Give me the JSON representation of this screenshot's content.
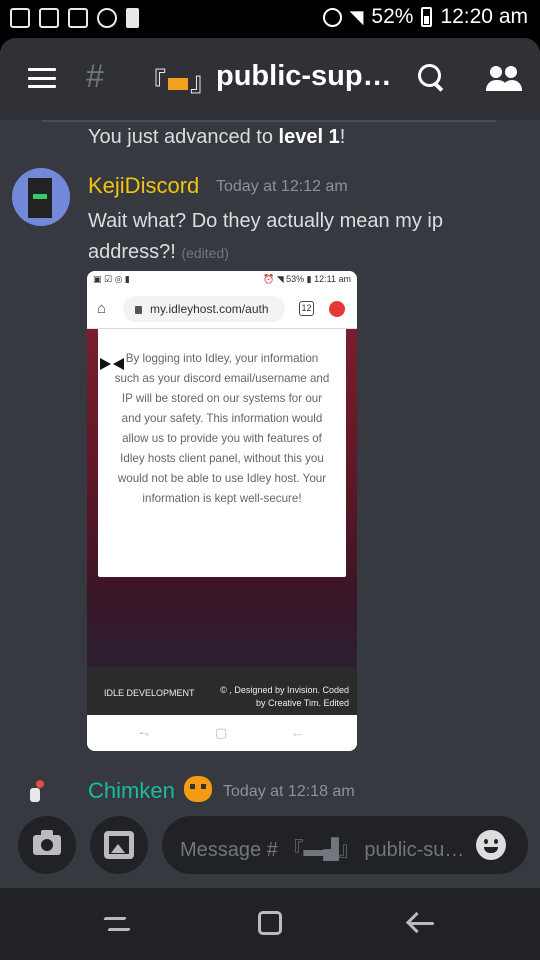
{
  "status_bar": {
    "battery": "52%",
    "time": "12:20 am"
  },
  "header": {
    "channel_name": "public-supp..."
  },
  "messages": {
    "system_prefix": "You just advanced to ",
    "system_level": "level 1",
    "system_suffix": "!",
    "first": {
      "author": "KejiDiscord",
      "author_color": "#f1c40f",
      "timestamp": "Today at 12:12 am",
      "text": "Wait what? Do they actually mean my ip address?!",
      "edited": "(edited)"
    },
    "attachment": {
      "status_battery": "53%",
      "status_time": "12:11 am",
      "url": "my.idleyhost.com/auth",
      "tab_count": "12",
      "notice": "By logging into Idley, your information such as your discord email/username and IP will be stored on our systems for our and your safety. This information would allow us to provide you with features of Idley hosts client panel, without this you would not be able to use Idley host. Your information is kept well-secure!",
      "footer_left": "IDLE DEVELOPMENT",
      "footer_right": "© , Designed by Invision. Coded by Creative Tim. Edited"
    },
    "second": {
      "author": "Chimken",
      "author_color": "#1abc9c",
      "timestamp": "Today at 12:18 am"
    }
  },
  "input": {
    "placeholder": "Message # 『▬▟』 public-supp..."
  }
}
